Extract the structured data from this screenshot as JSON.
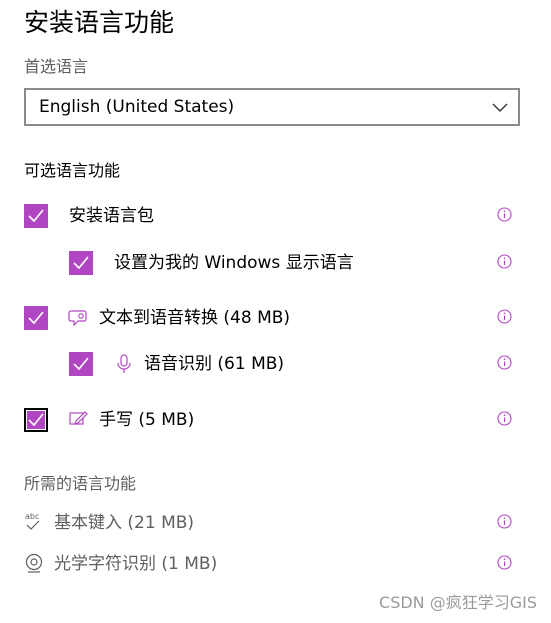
{
  "page": {
    "title": "安装语言功能"
  },
  "preferred_language": {
    "label": "首选语言",
    "selected_value": "English (United States)"
  },
  "optional_features": {
    "label": "可选语言功能",
    "items": [
      {
        "label": "安装语言包",
        "checked": true,
        "icon": "none",
        "info_icon": "info-icon"
      },
      {
        "label": "设置为我的 Windows 显示语言",
        "checked": true,
        "icon": "none",
        "info_icon": "info-icon"
      },
      {
        "label": "文本到语音转换 (48 MB)",
        "checked": true,
        "icon": "speech-bubble-icon",
        "info_icon": "info-icon"
      },
      {
        "label": "语音识别 (61 MB)",
        "checked": true,
        "icon": "microphone-icon",
        "info_icon": "info-icon"
      },
      {
        "label": "手写 (5 MB)",
        "checked": true,
        "focused": true,
        "icon": "pen-icon",
        "info_icon": "info-icon"
      }
    ]
  },
  "required_features": {
    "label": "所需的语言功能",
    "items": [
      {
        "label": "基本键入 (21 MB)",
        "icon": "abc-check-icon",
        "info_icon": "info-icon"
      },
      {
        "label": "光学字符识别 (1 MB)",
        "icon": "ocr-icon",
        "info_icon": "info-icon"
      }
    ]
  },
  "watermark": "CSDN @疯狂学习GIS",
  "colors": {
    "accent": "#b146c2",
    "text": "#000000",
    "secondary_text": "#5f5f5f",
    "dropdown_border": "#8a8a8a",
    "watermark": "#9a9a9a"
  }
}
